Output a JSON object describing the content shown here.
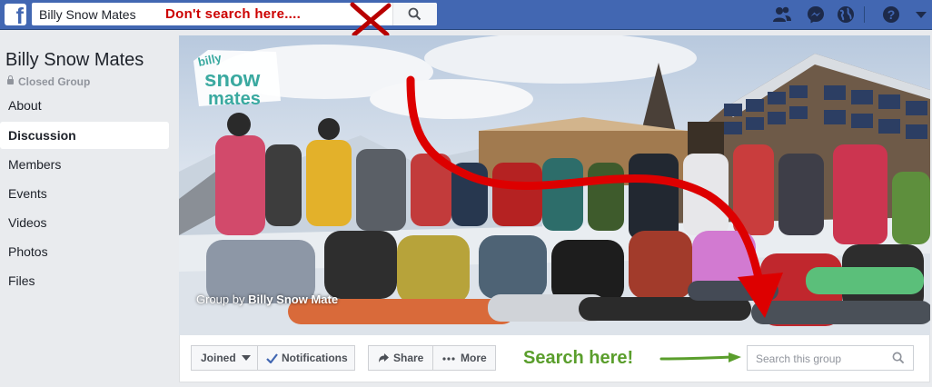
{
  "topbar": {
    "logo_letter": "f",
    "search_value": "Billy Snow Mates",
    "annotation_dont": "Don't search here....",
    "icons": [
      "friends-icon",
      "messenger-icon",
      "globe-icon",
      "help-icon",
      "caret-down-icon"
    ]
  },
  "sidebar": {
    "group_name": "Billy Snow Mates",
    "group_type": "Closed Group",
    "items": [
      {
        "label": "About"
      },
      {
        "label": "Discussion"
      },
      {
        "label": "Members"
      },
      {
        "label": "Events"
      },
      {
        "label": "Videos"
      },
      {
        "label": "Photos"
      },
      {
        "label": "Files"
      }
    ],
    "active_item": "Discussion"
  },
  "cover": {
    "caption_prefix": "Group by",
    "caption_owner": "Billy Snow Mate",
    "logo_line1": "billy",
    "logo_line2": "snow",
    "logo_line3": "mates"
  },
  "actions": {
    "joined": "Joined",
    "notifications": "Notifications",
    "share": "Share",
    "more": "More",
    "search_placeholder": "Search this group",
    "annotation_search": "Search here!"
  },
  "colors": {
    "brand": "#4267b2",
    "annotation_red": "#cc0000",
    "annotation_green": "#5a9e2c"
  }
}
